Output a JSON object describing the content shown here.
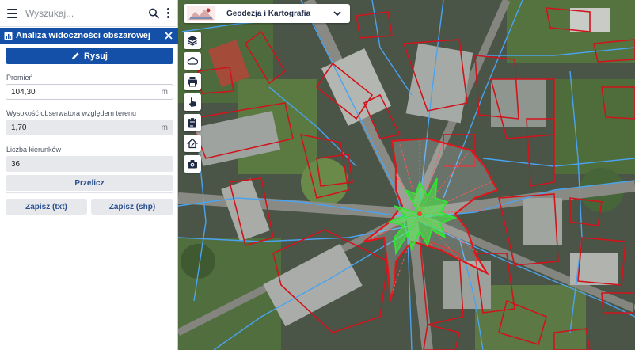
{
  "search": {
    "placeholder": "Wyszukaj..."
  },
  "app": {
    "name": "Geodezja i Kartografia"
  },
  "panel": {
    "title": "Analiza widoczności obszarowej",
    "draw_label": "Rysuj",
    "radius_label": "Promień",
    "radius_value": "104,30",
    "radius_unit": "m",
    "height_label": "Wysokość obserwatora względem terenu",
    "height_value": "1,70",
    "height_unit": "m",
    "directions_label": "Liczba kierunków",
    "directions_value": "36",
    "recalc_label": "Przelicz",
    "save_txt_label": "Zapisz (txt)",
    "save_shp_label": "Zapisz (shp)"
  },
  "tools": [
    "layers-icon",
    "cloud-icon",
    "print-icon",
    "touch-icon",
    "clipboard-icon",
    "home-measure-icon",
    "camera-icon"
  ],
  "colors": {
    "accent": "#1550a8",
    "parcel": "#d0141c",
    "viewshed": "#2ee82e",
    "network": "#4aa3f0"
  }
}
